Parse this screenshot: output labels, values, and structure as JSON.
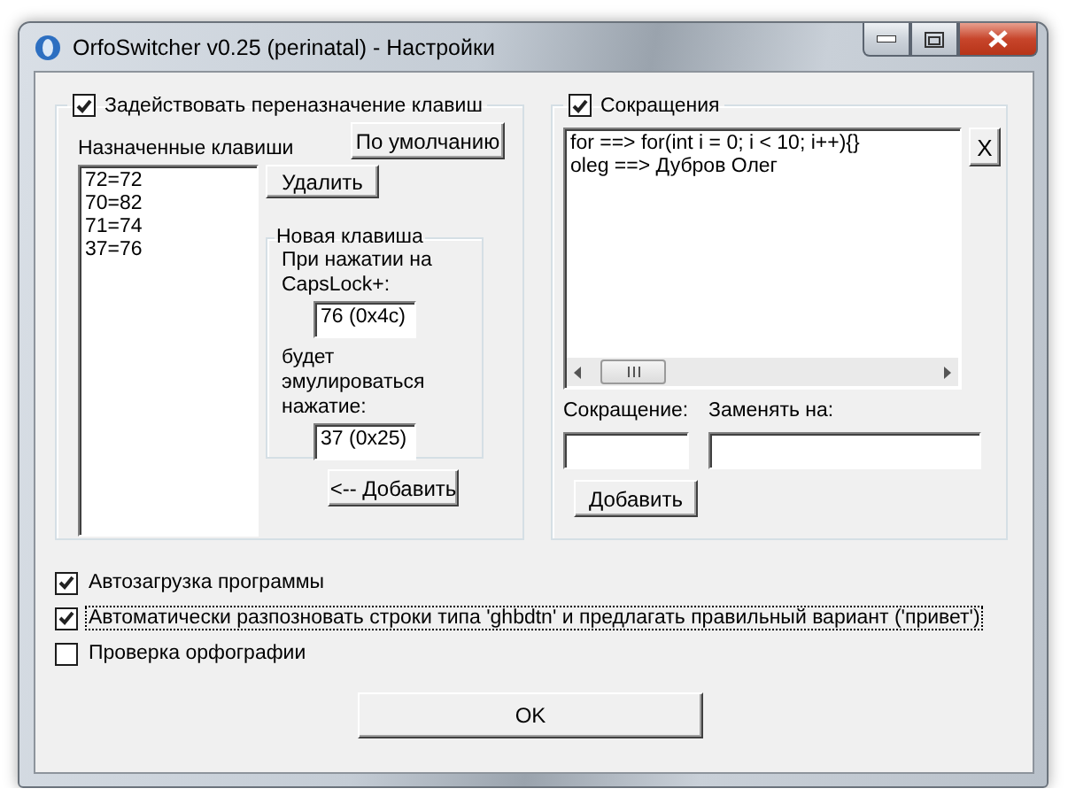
{
  "window": {
    "title": "OrfoSwitcher v0.25 (perinatal) - Настройки"
  },
  "remap": {
    "label": "Задействовать переназначение клавиш",
    "checked": true,
    "assigned_label": "Назначенные клавиши",
    "default_button": "По умолчанию",
    "keys": [
      "72=72",
      "70=82",
      "71=74",
      "37=76"
    ],
    "delete_button": "Удалить",
    "new_key": {
      "title": "Новая клавиша",
      "press_label": "При нажатии на CapsLock+:",
      "press_value": "76 (0x4c)",
      "emulate_label": "будет эмулироваться нажатие:",
      "emulate_value": "37 (0x25)",
      "add_button": "<-- Добавить"
    }
  },
  "abbreviations": {
    "label": "Сокращения",
    "checked": true,
    "entries": [
      "for ==> for(int i = 0; i < 10; i++){}",
      "oleg ==> Дубров Олег"
    ],
    "remove_button": "X",
    "abbr_label": "Сокращение:",
    "replace_label": "Заменять на:",
    "add_button": "Добавить"
  },
  "options": [
    {
      "label": "Автозагрузка программы",
      "checked": true,
      "focused": false
    },
    {
      "label": "Автоматически разпозновать строки типа 'ghbdtn' и предлагать правильный вариант ('привет')",
      "checked": true,
      "focused": true
    },
    {
      "label": "Проверка орфографии",
      "checked": false,
      "focused": false
    }
  ],
  "ok_button": "OK"
}
